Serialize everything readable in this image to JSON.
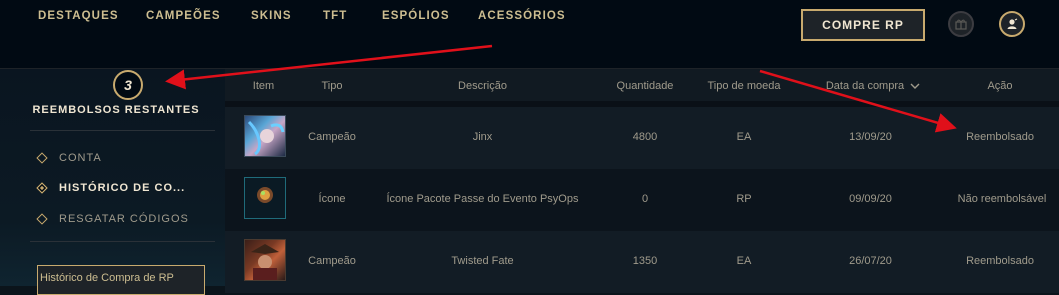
{
  "nav": {
    "items": [
      "DESTAQUES",
      "CAMPEÕES",
      "SKINS",
      "TFT",
      "ESPÓLIOS",
      "ACESSÓRIOS"
    ],
    "buy_rp": "COMPRE RP",
    "gift_icon": "gift-icon",
    "profile_icon": "profile-icon"
  },
  "sidebar": {
    "refund_count": "3",
    "refund_label": "REEMBOLSOS RESTANTES",
    "items": [
      {
        "label": "CONTA",
        "active": false
      },
      {
        "label": "HISTÓRICO DE CO...",
        "active": true
      },
      {
        "label": "RESGATAR CÓDIGOS",
        "active": false
      }
    ],
    "history_button": "Histórico de Compra de RP"
  },
  "table": {
    "headers": {
      "item": "Item",
      "type": "Tipo",
      "description": "Descrição",
      "quantity": "Quantidade",
      "currency": "Tipo de moeda",
      "date": "Data da compra",
      "action": "Ação"
    },
    "sort_icon": "chevron-down-icon",
    "rows": [
      {
        "type": "Campeão",
        "description": "Jinx",
        "quantity": "4800",
        "currency": "EA",
        "date": "13/09/20",
        "action": "Reembolsado"
      },
      {
        "type": "Ícone",
        "description": "Ícone Pacote Passe do Evento PsyOps",
        "quantity": "0",
        "currency": "RP",
        "date": "09/09/20",
        "action": "Não reembolsável"
      },
      {
        "type": "Campeão",
        "description": "Twisted Fate",
        "quantity": "1350",
        "currency": "EA",
        "date": "26/07/20",
        "action": "Reembolsado"
      }
    ]
  },
  "colors": {
    "gold": "#c8aa6e",
    "annotation_red": "#e0101a",
    "bg": "#010a13"
  }
}
